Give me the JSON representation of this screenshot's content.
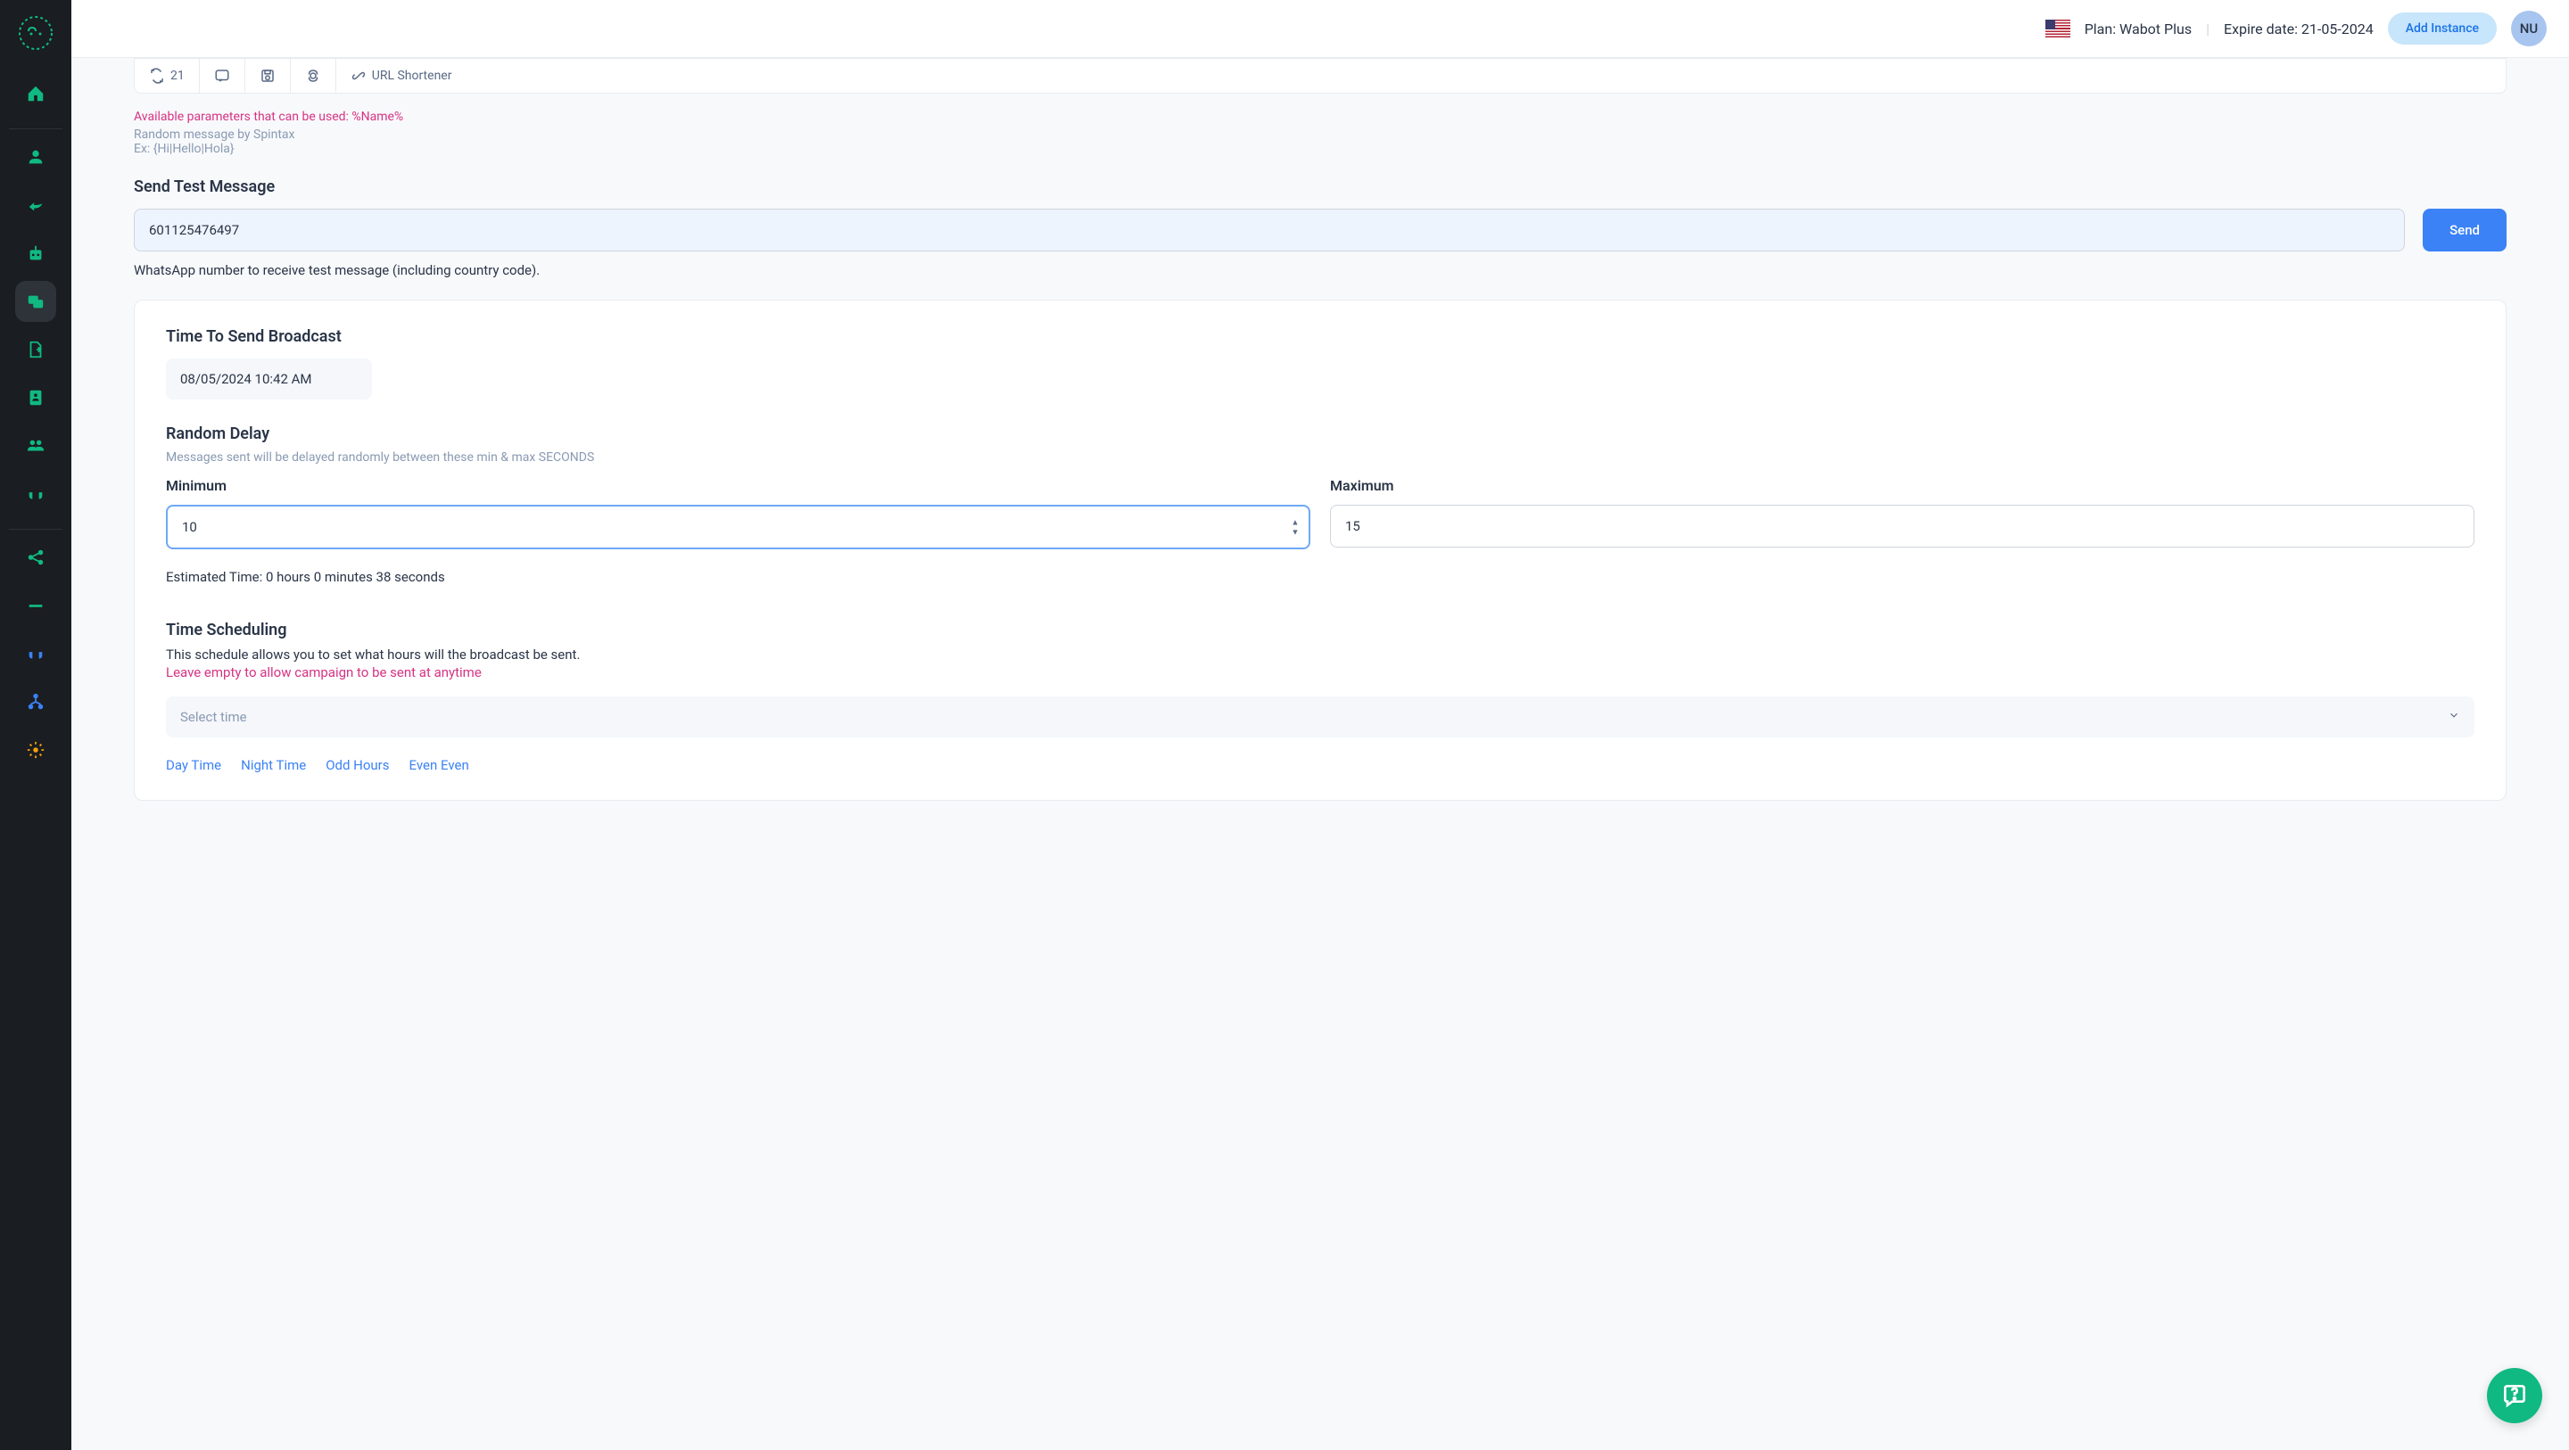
{
  "header": {
    "plan": "Plan: Wabot Plus",
    "expire": "Expire date: 21-05-2024",
    "add_instance": "Add Instance",
    "avatar": "NU"
  },
  "toolbar": {
    "count": "21",
    "url_shortener": "URL Shortener"
  },
  "hints": {
    "params": "Available parameters that can be used: %Name%",
    "spintax1": "Random message by Spintax",
    "spintax2": "Ex: {Hi|Hello|Hola}"
  },
  "test": {
    "title": "Send Test Message",
    "phone": "601125476497",
    "send": "Send",
    "help": "WhatsApp number to receive test message (including country code)."
  },
  "broadcast": {
    "time_title": "Time To Send Broadcast",
    "time_value": "08/05/2024 10:42 AM",
    "delay_title": "Random Delay",
    "delay_sub": "Messages sent will be delayed randomly between these min & max SECONDS",
    "min_label": "Minimum",
    "min_value": "10",
    "max_label": "Maximum",
    "max_value": "15",
    "estimated": "Estimated Time: 0 hours 0 minutes 38 seconds",
    "sched_title": "Time Scheduling",
    "sched_desc": "This schedule allows you to set what hours will the broadcast be sent.",
    "sched_red": "Leave empty to allow campaign to be sent at anytime",
    "select_placeholder": "Select time",
    "link_day": "Day Time",
    "link_night": "Night Time",
    "link_odd": "Odd Hours",
    "link_even": "Even Even"
  }
}
